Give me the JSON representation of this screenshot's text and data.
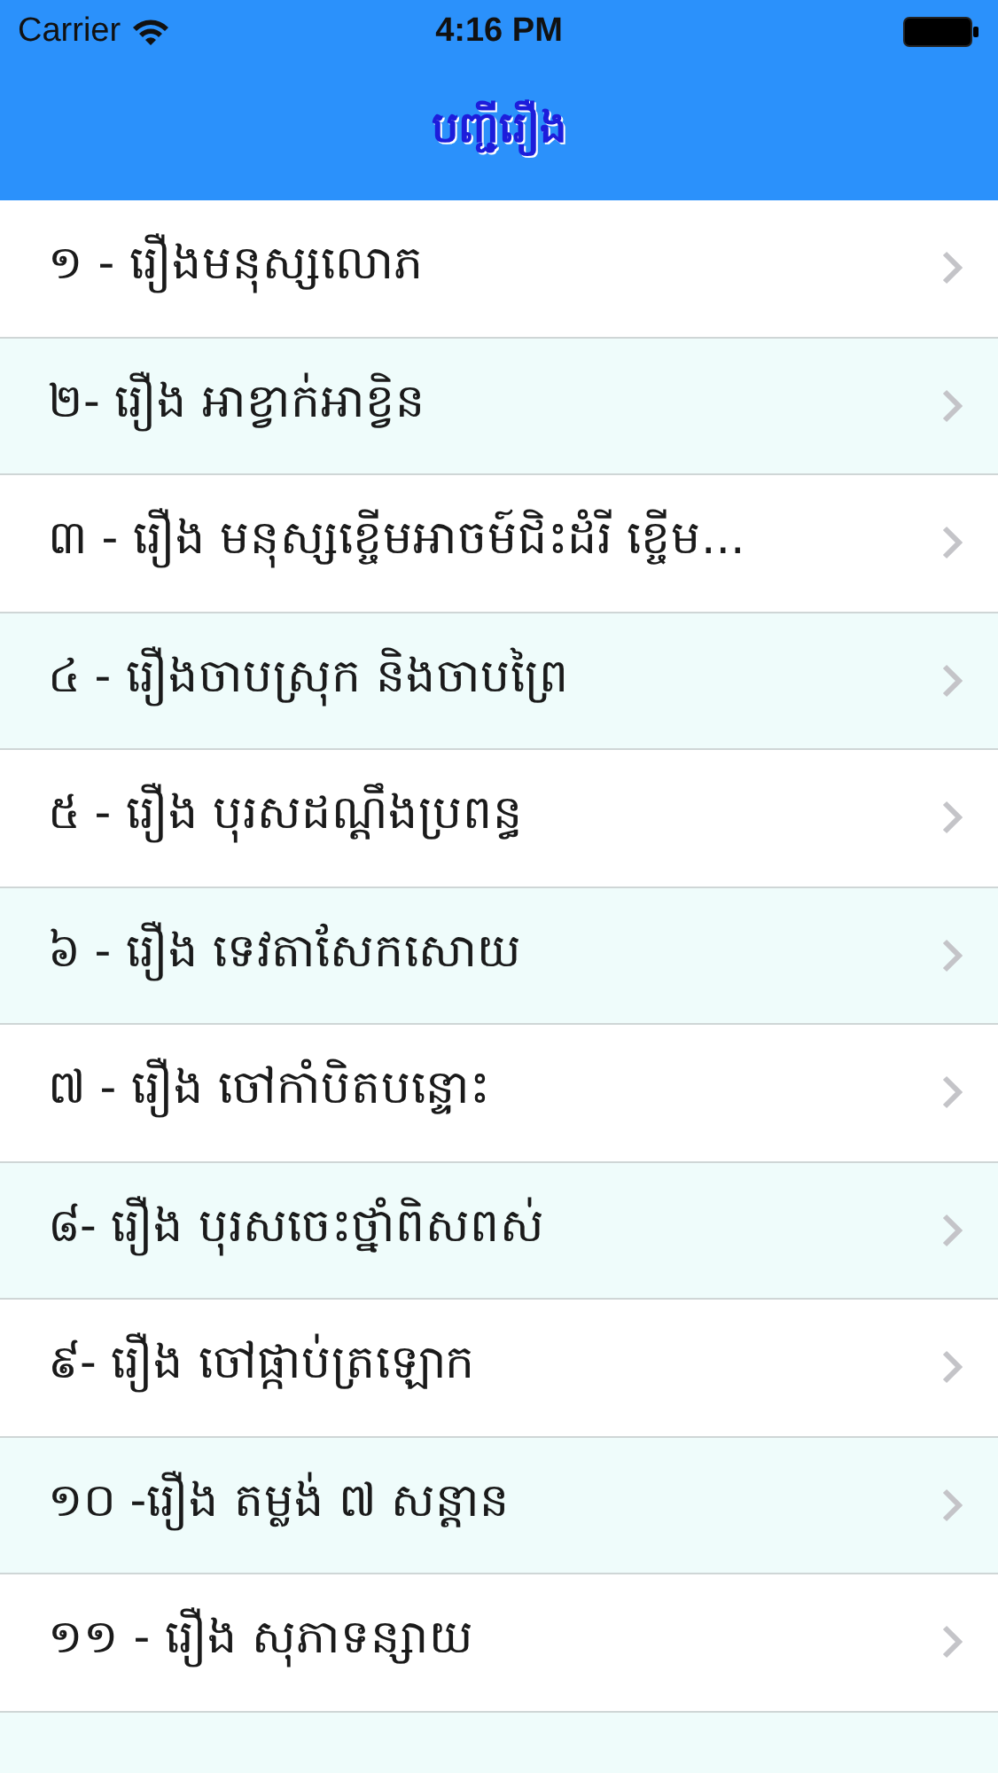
{
  "status_bar": {
    "carrier": "Carrier",
    "time": "4:16 PM"
  },
  "nav_bar": {
    "title": "បញ្ជីរឿង"
  },
  "stories": [
    {
      "title": "១ - រឿងមនុស្សលោភ"
    },
    {
      "title": "២- រឿង អាខ្វាក់អាខ្វិន"
    },
    {
      "title": "៣ - រឿង មនុស្សខ្ចើមអាចម៍ជិះដំរី ខ្ចើម..."
    },
    {
      "title": "៤ - រឿងចាបស្រុក និងចាបព្រៃ"
    },
    {
      "title": "៥ - រឿង បុរសដណ្ដឹងប្រពន្ធ"
    },
    {
      "title": "៦ - រឿង ទេវតាសែកសោយ"
    },
    {
      "title": "៧ - រឿង ចៅកាំបិតបន្ទោះ"
    },
    {
      "title": "៨- រឿង បុរសចេះថ្នាំពិសពស់"
    },
    {
      "title": "៩- រឿង ចៅផ្កាប់ត្រឡោក"
    },
    {
      "title": "១០ -រឿង តម្លង់ ៧ សន្ដាន"
    },
    {
      "title": "១១ - រឿង សុភាទន្សាយ"
    }
  ]
}
